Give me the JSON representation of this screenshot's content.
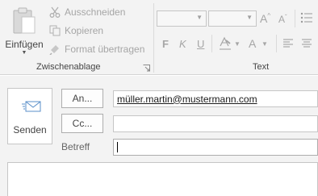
{
  "ribbon": {
    "clipboard": {
      "paste_label": "Einfügen",
      "paste_icon": "clipboard-icon",
      "cut_label": "Ausschneiden",
      "cut_icon": "scissors-icon",
      "copy_label": "Kopieren",
      "copy_icon": "copy-icon",
      "format_label": "Format übertragen",
      "format_icon": "format-painter-icon",
      "group_label": "Zwischenablage"
    },
    "text": {
      "font_name": "",
      "font_size": "",
      "grow_font": "A",
      "shrink_font": "A",
      "bold": "F",
      "italic": "K",
      "underline": "U",
      "font_color": "A",
      "group_label": "Text"
    }
  },
  "compose": {
    "send_label": "Senden",
    "send_icon": "envelope-send-icon",
    "to_button": "An...",
    "cc_button": "Cc...",
    "to_value": "müller.martin@mustermann.com",
    "cc_value": "",
    "subject_label": "Betreff",
    "subject_value": ""
  },
  "colors": {
    "ribbon_bg": "#f3f3f3",
    "disabled_text": "#a6a6a6",
    "border": "#c6c6c6"
  }
}
